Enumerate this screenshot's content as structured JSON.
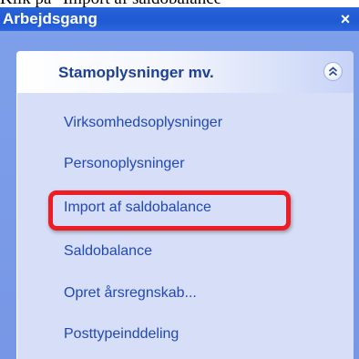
{
  "top_cut_text": "Klik på \"Import af saldobalance\"",
  "pane": {
    "title": "Arbejdsgang",
    "close_glyph": "×"
  },
  "group": {
    "title": "Stamoplysninger mv.",
    "collapse_icon": "double-chevron-up-icon",
    "items": [
      {
        "label": "Virksomhedsoplysninger"
      },
      {
        "label": "Personoplysninger"
      },
      {
        "label": "Import af saldobalance",
        "highlighted": true
      },
      {
        "label": "Saldobalance"
      },
      {
        "label": "Opret årsregnskab..."
      },
      {
        "label": "Posttypeinddeling"
      }
    ]
  },
  "colors": {
    "pane_header": "#1f59d4",
    "pane_background": "#7797e6",
    "group_body": "#d6dff7",
    "link_text": "#2148b8",
    "group_title": "#1c3f9a",
    "highlight_frame": "#ee1c24"
  }
}
